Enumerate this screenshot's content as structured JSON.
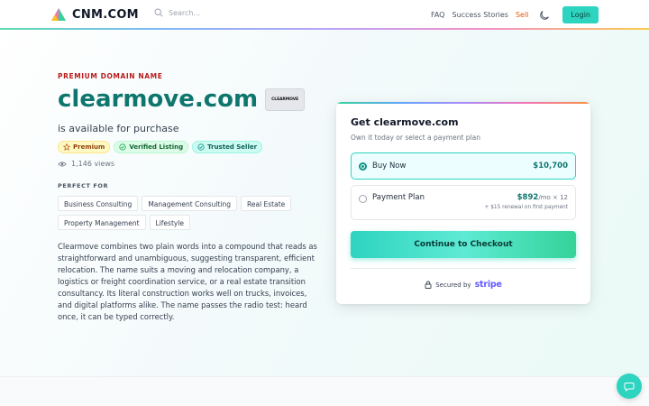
{
  "header": {
    "brand": "CNM.COM",
    "search_placeholder": "Search...",
    "nav": [
      "FAQ",
      "Success Stories",
      "Sell"
    ],
    "login_label": "Login"
  },
  "hero": {
    "eyebrow": "PREMIUM DOMAIN NAME",
    "domain": "clearmove.com",
    "logo_text": "CLEARMOVE",
    "availability": "is available for purchase",
    "badges": [
      "Premium",
      "Verified Listing",
      "Trusted Seller"
    ],
    "views": "1,146 views",
    "perfect_for_label": "PERFECT FOR",
    "tags": [
      "Business Consulting",
      "Management Consulting",
      "Real Estate",
      "Property Management",
      "Lifestyle"
    ],
    "description": "Clearmove combines two plain words into a compound that reads as straightforward and unambiguous, suggesting transparent, efficient relocation. The name suits a moving and relocation company, a logistics or freight coordination service, or a real estate transition consultancy. Its literal construction works well on trucks, invoices, and digital platforms alike. The name passes the radio test: heard once, it can be typed correctly."
  },
  "purchase": {
    "title": "Get clearmove.com",
    "subtitle": "Own it today or select a payment plan",
    "buy_now": {
      "label": "Buy Now",
      "price": "$10,700",
      "selected": true
    },
    "payment_plan": {
      "label": "Payment Plan",
      "price": "$892",
      "suffix": "/mo × 12",
      "renewal": "+ $15 renewal on first payment",
      "selected": false
    },
    "checkout_label": "Continue to Checkout",
    "secured_label": "Secured by",
    "secured_brand": "stripe"
  },
  "colors": {
    "accent": "#2dd4bf",
    "domain_text": "#0f766e",
    "eyebrow": "#b91c1c",
    "sell_link": "#ea580c"
  },
  "icons": [
    "logo-mark-icon",
    "search-icon",
    "moon-icon",
    "star-icon",
    "check-circle-icon",
    "shield-check-icon",
    "eye-icon",
    "lock-icon",
    "chat-icon"
  ]
}
